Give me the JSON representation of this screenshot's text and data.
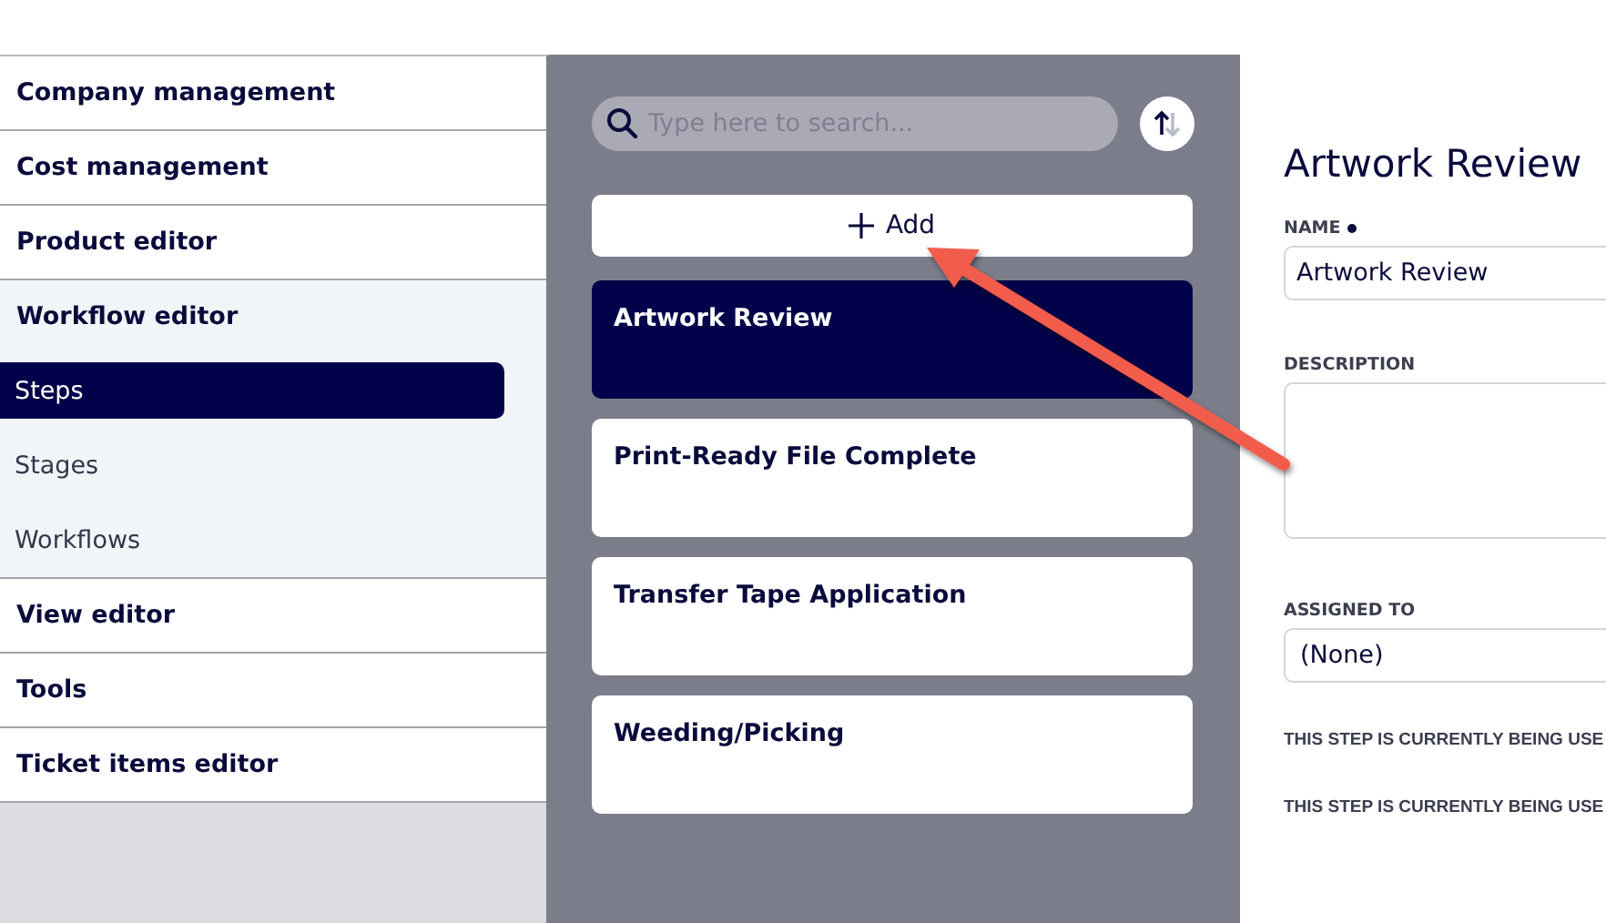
{
  "sidebar": {
    "items": [
      {
        "label": "Company management",
        "expanded": false
      },
      {
        "label": "Cost management",
        "expanded": false
      },
      {
        "label": "Product editor",
        "expanded": false
      },
      {
        "label": "Workflow editor",
        "expanded": true,
        "children": [
          {
            "label": "Steps",
            "selected": true
          },
          {
            "label": "Stages",
            "selected": false
          },
          {
            "label": "Workflows",
            "selected": false
          }
        ]
      },
      {
        "label": "View editor",
        "expanded": false
      },
      {
        "label": "Tools",
        "expanded": false
      },
      {
        "label": "Ticket items editor",
        "expanded": false
      }
    ]
  },
  "list": {
    "search": {
      "placeholder": "Type here to search..."
    },
    "add_button": {
      "label": "Add"
    },
    "cards": [
      {
        "title": "Artwork Review",
        "selected": true
      },
      {
        "title": "Print-Ready File Complete",
        "selected": false
      },
      {
        "title": "Transfer Tape Application",
        "selected": false
      },
      {
        "title": "Weeding/Picking",
        "selected": false
      }
    ]
  },
  "detail": {
    "title": "Artwork Review",
    "fields": [
      {
        "kind": "input",
        "label": "NAME",
        "required": true,
        "value": "Artwork Review"
      },
      {
        "kind": "textarea",
        "label": "DESCRIPTION"
      },
      {
        "kind": "select",
        "label": "ASSIGNED TO",
        "value": "(None)"
      }
    ],
    "notes": [
      "THIS STEP IS CURRENTLY BEING USE",
      "THIS STEP IS CURRENTLY BEING USE"
    ]
  },
  "annotations": [
    {
      "kind": "arrow"
    }
  ]
}
